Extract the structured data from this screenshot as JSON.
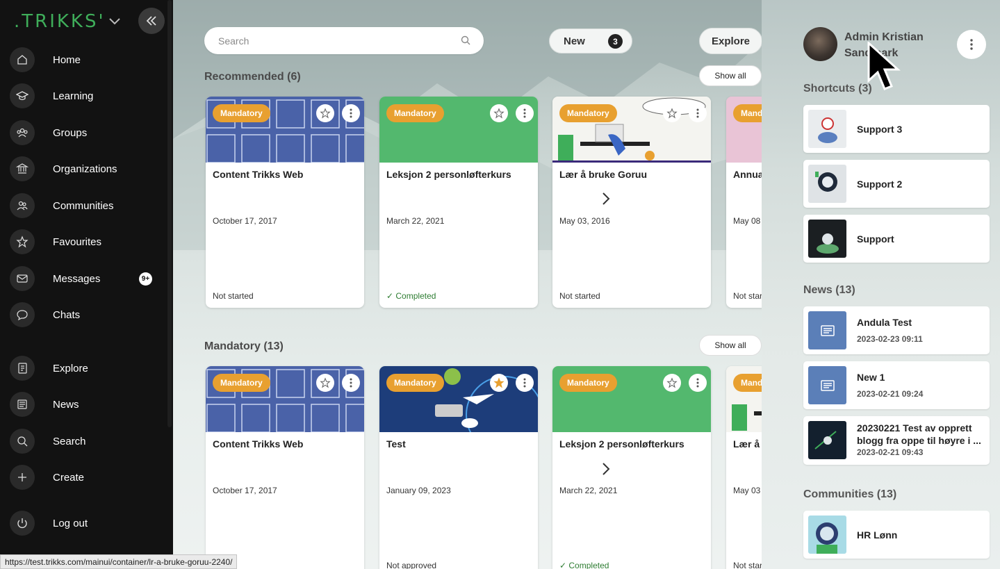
{
  "brand": {
    "logo": ".TRIKKS'"
  },
  "sidebar": {
    "items": [
      {
        "label": "Home",
        "icon": "home-icon"
      },
      {
        "label": "Learning",
        "icon": "graduation-cap-icon"
      },
      {
        "label": "Groups",
        "icon": "groups-icon"
      },
      {
        "label": "Organizations",
        "icon": "bank-icon"
      },
      {
        "label": "Communities",
        "icon": "community-icon"
      },
      {
        "label": "Favourites",
        "icon": "star-icon"
      },
      {
        "label": "Messages",
        "icon": "envelope-icon",
        "badge": "9+"
      },
      {
        "label": "Chats",
        "icon": "chat-bubble-icon"
      },
      {
        "label": "Explore",
        "icon": "book-icon"
      },
      {
        "label": "News",
        "icon": "newspaper-icon"
      },
      {
        "label": "Search",
        "icon": "search-icon"
      },
      {
        "label": "Create",
        "icon": "plus-icon"
      },
      {
        "label": "Log out",
        "icon": "power-icon"
      }
    ]
  },
  "topbar": {
    "search_placeholder": "Search",
    "new_label": "New",
    "new_count": "3",
    "explore_label": "Explore"
  },
  "recommended": {
    "title": "Recommended (6)",
    "show_all": "Show all",
    "cards": [
      {
        "badge": "Mandatory",
        "title": "Content Trikks Web",
        "date": "October 17, 2017",
        "status": "Not started",
        "starred": false
      },
      {
        "badge": "Mandatory",
        "title": "Leksjon 2 personløfterkurs",
        "date": "March 22, 2021",
        "status": "Completed",
        "starred": false
      },
      {
        "badge": "Mandatory",
        "title": "Lær å bruke Goruu",
        "date": "May 03, 2016",
        "status": "Not started",
        "starred": false
      },
      {
        "badge": "Mandatory",
        "title": "Annual",
        "date": "May 08",
        "status": "Not start",
        "starred": false
      }
    ]
  },
  "mandatory": {
    "title": "Mandatory (13)",
    "show_all": "Show all",
    "cards": [
      {
        "badge": "Mandatory",
        "title": "Content Trikks Web",
        "date": "October 17, 2017",
        "status": "",
        "starred": false
      },
      {
        "badge": "Mandatory",
        "title": "Test",
        "date": "January 09, 2023",
        "status": "Not approved",
        "starred": true
      },
      {
        "badge": "Mandatory",
        "title": "Leksjon 2 personløfterkurs",
        "date": "March 22, 2021",
        "status": "Completed",
        "starred": false
      },
      {
        "badge": "Mandatory",
        "title": "Lær å",
        "date": "May 03",
        "status": "Not star",
        "starred": false
      }
    ]
  },
  "user": {
    "name": "Admin Kristian Sandmark"
  },
  "shortcuts": {
    "title": "Shortcuts (3)",
    "items": [
      {
        "label": "Support 3"
      },
      {
        "label": "Support 2"
      },
      {
        "label": "Support"
      }
    ]
  },
  "news": {
    "title": "News (13)",
    "items": [
      {
        "title": "Andula Test",
        "date": "2023-02-23 09:11"
      },
      {
        "title": "New 1",
        "date": "2023-02-21 09:24"
      },
      {
        "title": "20230221 Test av opprett blogg fra oppe til høyre i ...",
        "date": "2023-02-21 09:43"
      }
    ]
  },
  "communities": {
    "title": "Communities (13)",
    "items": [
      {
        "label": "HR Lønn"
      }
    ]
  },
  "status_bar": {
    "url": "https://test.trikks.com/mainui/container/lr-a-bruke-goruu-2240/"
  },
  "colors": {
    "accent_green": "#3fae5a",
    "mandatory_orange": "#e8a030",
    "sidebar_bg": "#121212"
  }
}
